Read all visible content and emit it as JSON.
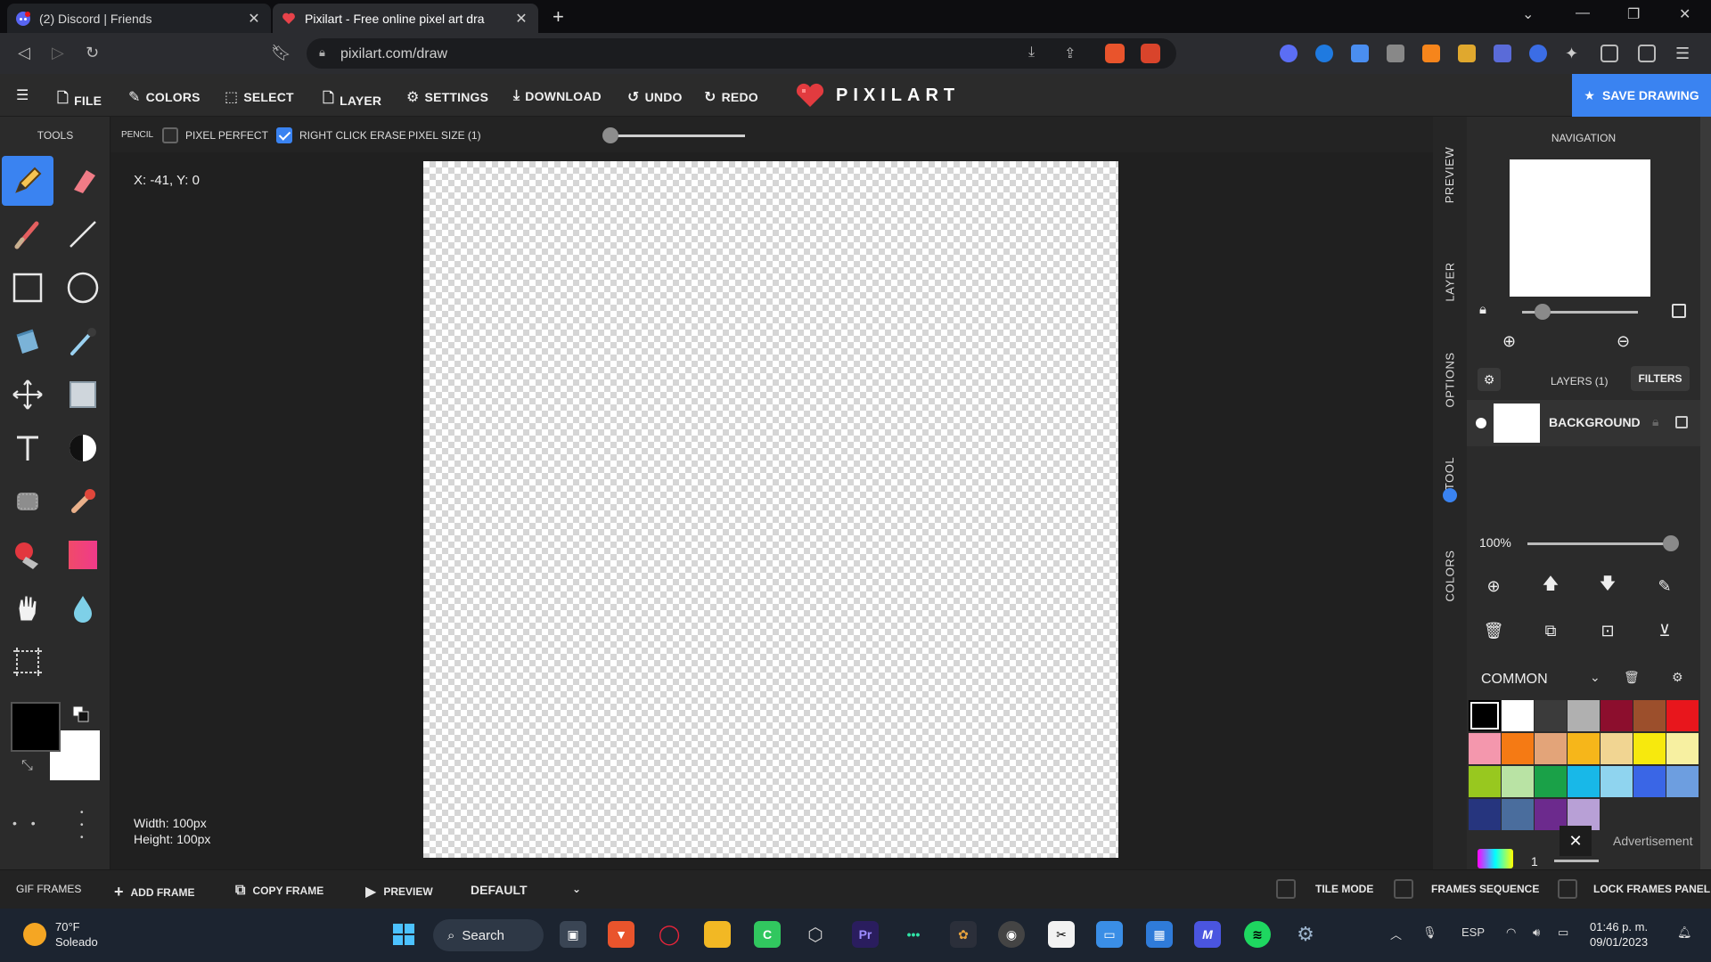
{
  "browser": {
    "tabs": [
      {
        "title": "(2) Discord | Friends",
        "active": false
      },
      {
        "title": "Pixilart - Free online pixel art dra",
        "active": true
      }
    ],
    "url": "pixilart.com/draw"
  },
  "menu": {
    "file": "FILE",
    "colors": "COLORS",
    "select": "SELECT",
    "layer": "LAYER",
    "settings": "SETTINGS",
    "download": "DOWNLOAD",
    "undo": "UNDO",
    "redo": "REDO",
    "logo": "PIXILART",
    "save": "SAVE DRAWING"
  },
  "tools": {
    "title": "TOOLS",
    "items": [
      "pencil-icon",
      "eraser-icon",
      "brush-icon",
      "line-icon",
      "rectangle-icon",
      "circle-icon",
      "bucket-icon",
      "eyedropper-icon",
      "move-icon",
      "select-icon",
      "text-icon",
      "dither-icon",
      "spray-icon",
      "stamp-icon",
      "shade-icon",
      "gradient-icon",
      "hand-icon",
      "blur-icon",
      "crop-icon"
    ],
    "active": "pencil-icon",
    "primary_color": "#000000",
    "secondary_color": "#ffffff"
  },
  "options": {
    "tool_label": "PENCIL",
    "pixel_perfect_label": "PIXEL PERFECT",
    "pixel_perfect": false,
    "right_click_erase_label": "RIGHT CLICK ERASE",
    "right_click_erase": true,
    "pixel_size_label": "PIXEL SIZE (1)"
  },
  "workspace": {
    "coords": "X: -41, Y: 0",
    "width_text": "Width: 100px",
    "height_text": "Height: 100px"
  },
  "right_tabs": [
    "PREVIEW",
    "LAYER",
    "OPTIONS",
    "TOOL",
    "COLORS"
  ],
  "navigation": {
    "title": "NAVIGATION"
  },
  "layers": {
    "title": "LAYERS (1)",
    "filters": "FILTERS",
    "items": [
      {
        "name": "BACKGROUND"
      }
    ],
    "opacity": "100%"
  },
  "palette": {
    "name": "COMMON",
    "colors": [
      "#000000",
      "#ffffff",
      "#3b3b3b",
      "#b0b0b0",
      "#8c0e2d",
      "#9c4f2c",
      "#e8161c",
      "#f497ad",
      "#f57a14",
      "#e3a479",
      "#f6b61a",
      "#f1d592",
      "#f7e90d",
      "#f7f0a1",
      "#98c81f",
      "#b9e3a4",
      "#1aa148",
      "#18b8e8",
      "#8fd4ef",
      "#3a66e6",
      "#6d9ee0",
      "#26357e",
      "#4a6d9d",
      "#6c2a8d",
      "#b8a0d6"
    ],
    "selected_index": 0,
    "ad_label": "Advertisement",
    "page_number": "1"
  },
  "frames": {
    "gif_frames": "GIF FRAMES",
    "add_frame": "ADD FRAME",
    "copy_frame": "COPY FRAME",
    "preview": "PREVIEW",
    "default_speed": "DEFAULT",
    "tile_mode": "TILE MODE",
    "frames_sequence": "FRAMES SEQUENCE",
    "lock_frames_panel": "LOCK FRAMES PANEL"
  },
  "taskbar": {
    "temp": "70°F",
    "weather": "Soleado",
    "search": "Search",
    "lang": "ESP",
    "time": "01:46 p. m.",
    "date": "09/01/2023"
  }
}
